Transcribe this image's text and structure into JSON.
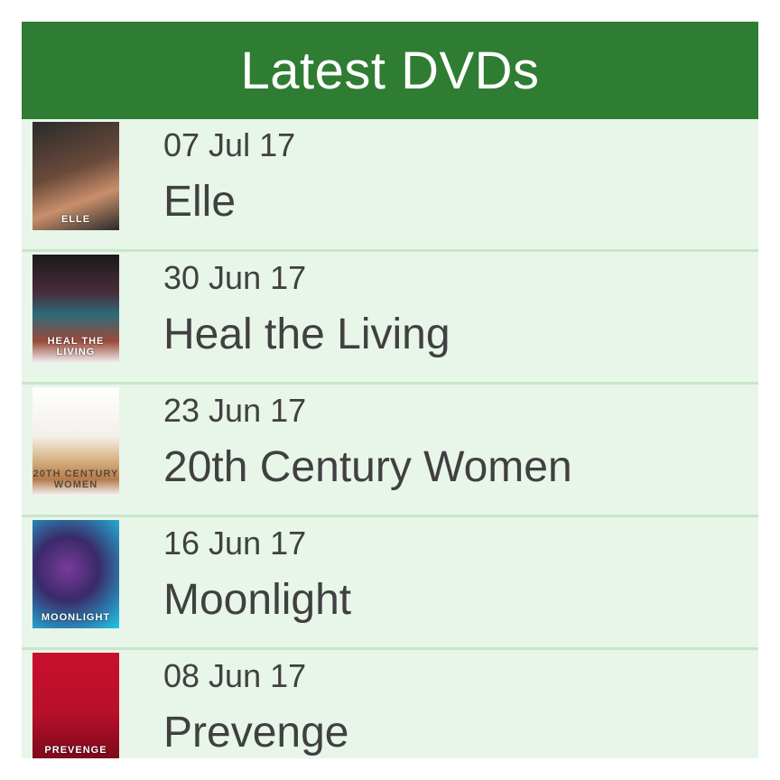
{
  "header": {
    "title": "Latest DVDs"
  },
  "items": [
    {
      "date": "07 Jul 17",
      "title": "Elle",
      "poster_text": "ELLE"
    },
    {
      "date": "30 Jun 17",
      "title": "Heal the Living",
      "poster_text": "HEAL THE LIVING"
    },
    {
      "date": "23 Jun 17",
      "title": "20th Century Women",
      "poster_text": "20TH CENTURY WOMEN"
    },
    {
      "date": "16 Jun 17",
      "title": "Moonlight",
      "poster_text": "MOONLIGHT"
    },
    {
      "date": "08 Jun 17",
      "title": "Prevenge",
      "poster_text": "PREVENGE"
    }
  ],
  "colors": {
    "header_bg": "#2e7d32",
    "row_bg": "#e8f5e9",
    "divider": "#c8e6c9",
    "text": "#404040"
  }
}
